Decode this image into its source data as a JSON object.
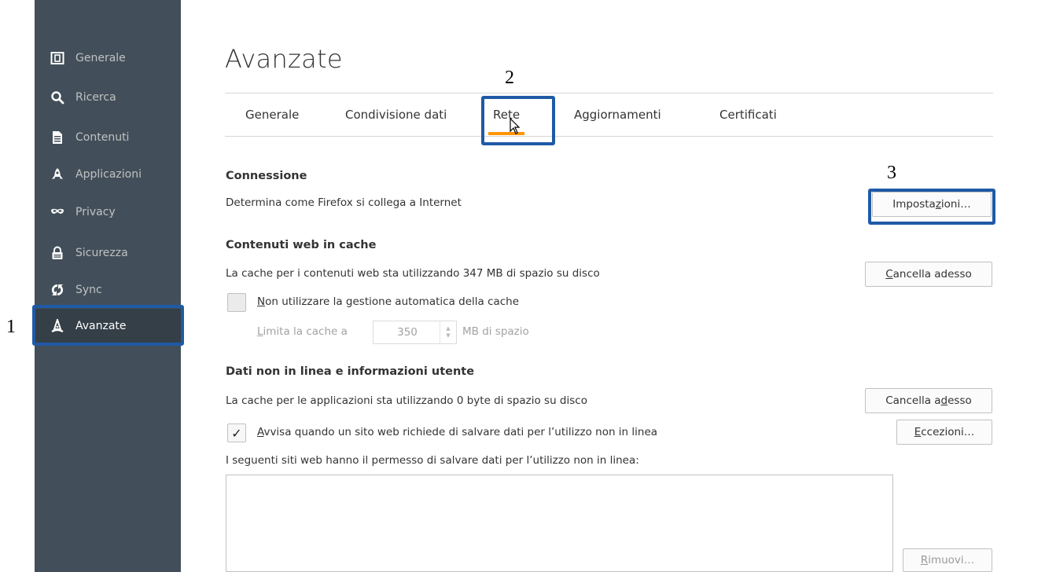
{
  "sidebar": {
    "items": [
      {
        "label": "Generale",
        "icon": "general-icon"
      },
      {
        "label": "Ricerca",
        "icon": "search-icon"
      },
      {
        "label": "Contenuti",
        "icon": "document-icon"
      },
      {
        "label": "Applicazioni",
        "icon": "rocket-icon"
      },
      {
        "label": "Privacy",
        "icon": "mask-icon"
      },
      {
        "label": "Sicurezza",
        "icon": "lock-icon"
      },
      {
        "label": "Sync",
        "icon": "sync-icon"
      },
      {
        "label": "Avanzate",
        "icon": "wizard-hat-icon"
      }
    ],
    "active": "Avanzate"
  },
  "page": {
    "title": "Avanzate",
    "tabs": [
      "Generale",
      "Condivisione dati",
      "Rete",
      "Aggiornamenti",
      "Certificati"
    ],
    "selected_tab": "Rete"
  },
  "connection": {
    "title": "Connessione",
    "description": "Determina come Firefox si collega a Internet",
    "settings_button": {
      "before": "Imposta",
      "accel": "z",
      "after": "ioni…"
    }
  },
  "web_cache": {
    "title": "Contenuti web in cache",
    "description": "La cache per i contenuti web sta utilizzando 347 MB di spazio su disco",
    "clear_button": {
      "before": "",
      "accel": "C",
      "after": "ancella adesso"
    },
    "override_checkbox": {
      "before": "",
      "accel": "N",
      "after": "on utilizzare la gestione automatica della cache",
      "checked": false
    },
    "limit_label": {
      "before": "",
      "accel": "L",
      "after": "imita la cache a"
    },
    "limit_value": "350",
    "limit_unit": "MB di spazio"
  },
  "offline": {
    "title": "Dati non in linea e informazioni utente",
    "description": "La cache per le applicazioni sta utilizzando 0 byte di spazio su disco",
    "clear_button": {
      "before": "Cancella a",
      "accel": "d",
      "after": "esso"
    },
    "notify_checkbox": {
      "before": "",
      "accel": "A",
      "after": "vvisa quando un sito web richiede di salvare dati per l’utilizzo non in linea",
      "checked": true,
      "mark": "✓"
    },
    "exceptions_button": {
      "before": "",
      "accel": "E",
      "after": "ccezioni…"
    },
    "sites_label": "I seguenti siti web hanno il permesso di salvare dati per l’utilizzo non in linea:",
    "remove_button": {
      "before": "",
      "accel": "R",
      "after": "imuovi…"
    }
  },
  "annotations": {
    "n1": "1",
    "n2": "2",
    "n3": "3",
    "color": "#1f5aa6"
  },
  "colors": {
    "sidebar_bg": "#424f5a",
    "sidebar_active": "#343f48",
    "tab_underline": "#ff9500"
  }
}
